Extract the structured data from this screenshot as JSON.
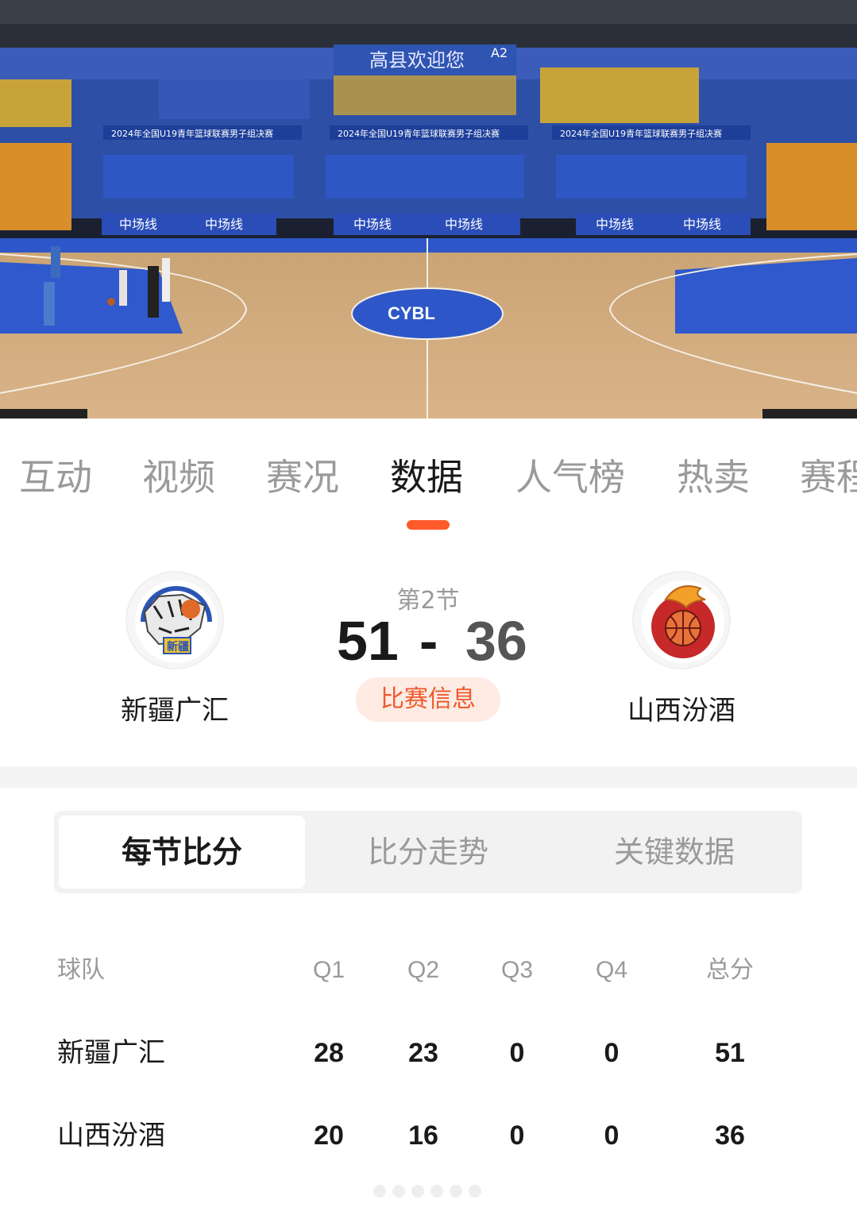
{
  "video": {
    "banner_text": "高县欢迎您",
    "section_label": "A2",
    "event_banner": "2024年全国U19青年篮球联赛男子组决赛",
    "sponsor": "中场线",
    "court_logo": "CYBL"
  },
  "tabs": [
    {
      "label": "互动"
    },
    {
      "label": "视频"
    },
    {
      "label": "赛况"
    },
    {
      "label": "数据"
    },
    {
      "label": "人气榜"
    },
    {
      "label": "热卖"
    },
    {
      "label": "赛程"
    }
  ],
  "active_tab": "数据",
  "match": {
    "period": "第2节",
    "home": {
      "name": "新疆广汇",
      "score": "51",
      "logo_text": "新疆"
    },
    "separator": "-",
    "away": {
      "name": "山西汾酒",
      "score": "36"
    },
    "info_button": "比赛信息"
  },
  "segments": [
    {
      "label": "每节比分"
    },
    {
      "label": "比分走势"
    },
    {
      "label": "关键数据"
    }
  ],
  "score_table": {
    "headers": [
      "球队",
      "Q1",
      "Q2",
      "Q3",
      "Q4",
      "总分"
    ],
    "rows": [
      [
        "新疆广汇",
        "28",
        "23",
        "0",
        "0",
        "51"
      ],
      [
        "山西汾酒",
        "20",
        "16",
        "0",
        "0",
        "36"
      ]
    ]
  },
  "colors": {
    "accent": "#ff5a2a",
    "info_button_bg": "#fdebe4",
    "info_button_text": "#f0582a"
  }
}
